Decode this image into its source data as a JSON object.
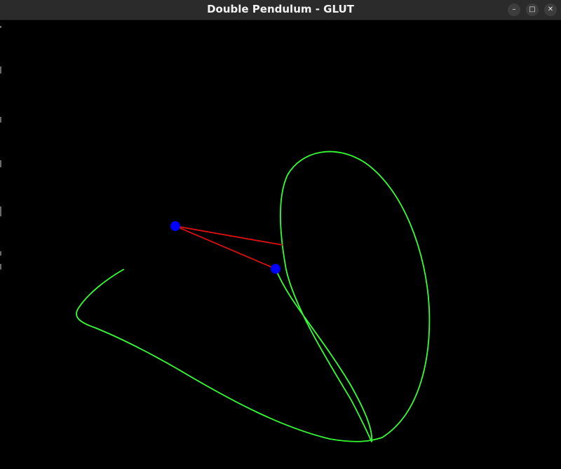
{
  "window": {
    "title": "Double Pendulum - GLUT",
    "controls": {
      "minimize_icon": "minimize-icon",
      "maximize_icon": "maximize-icon",
      "close_icon": "close-icon"
    }
  },
  "colors": {
    "background": "#000000",
    "titlebar": "#2b2b2b",
    "rod": "#e01010",
    "bob": "#0000ff",
    "trail": "#33ff33"
  }
}
